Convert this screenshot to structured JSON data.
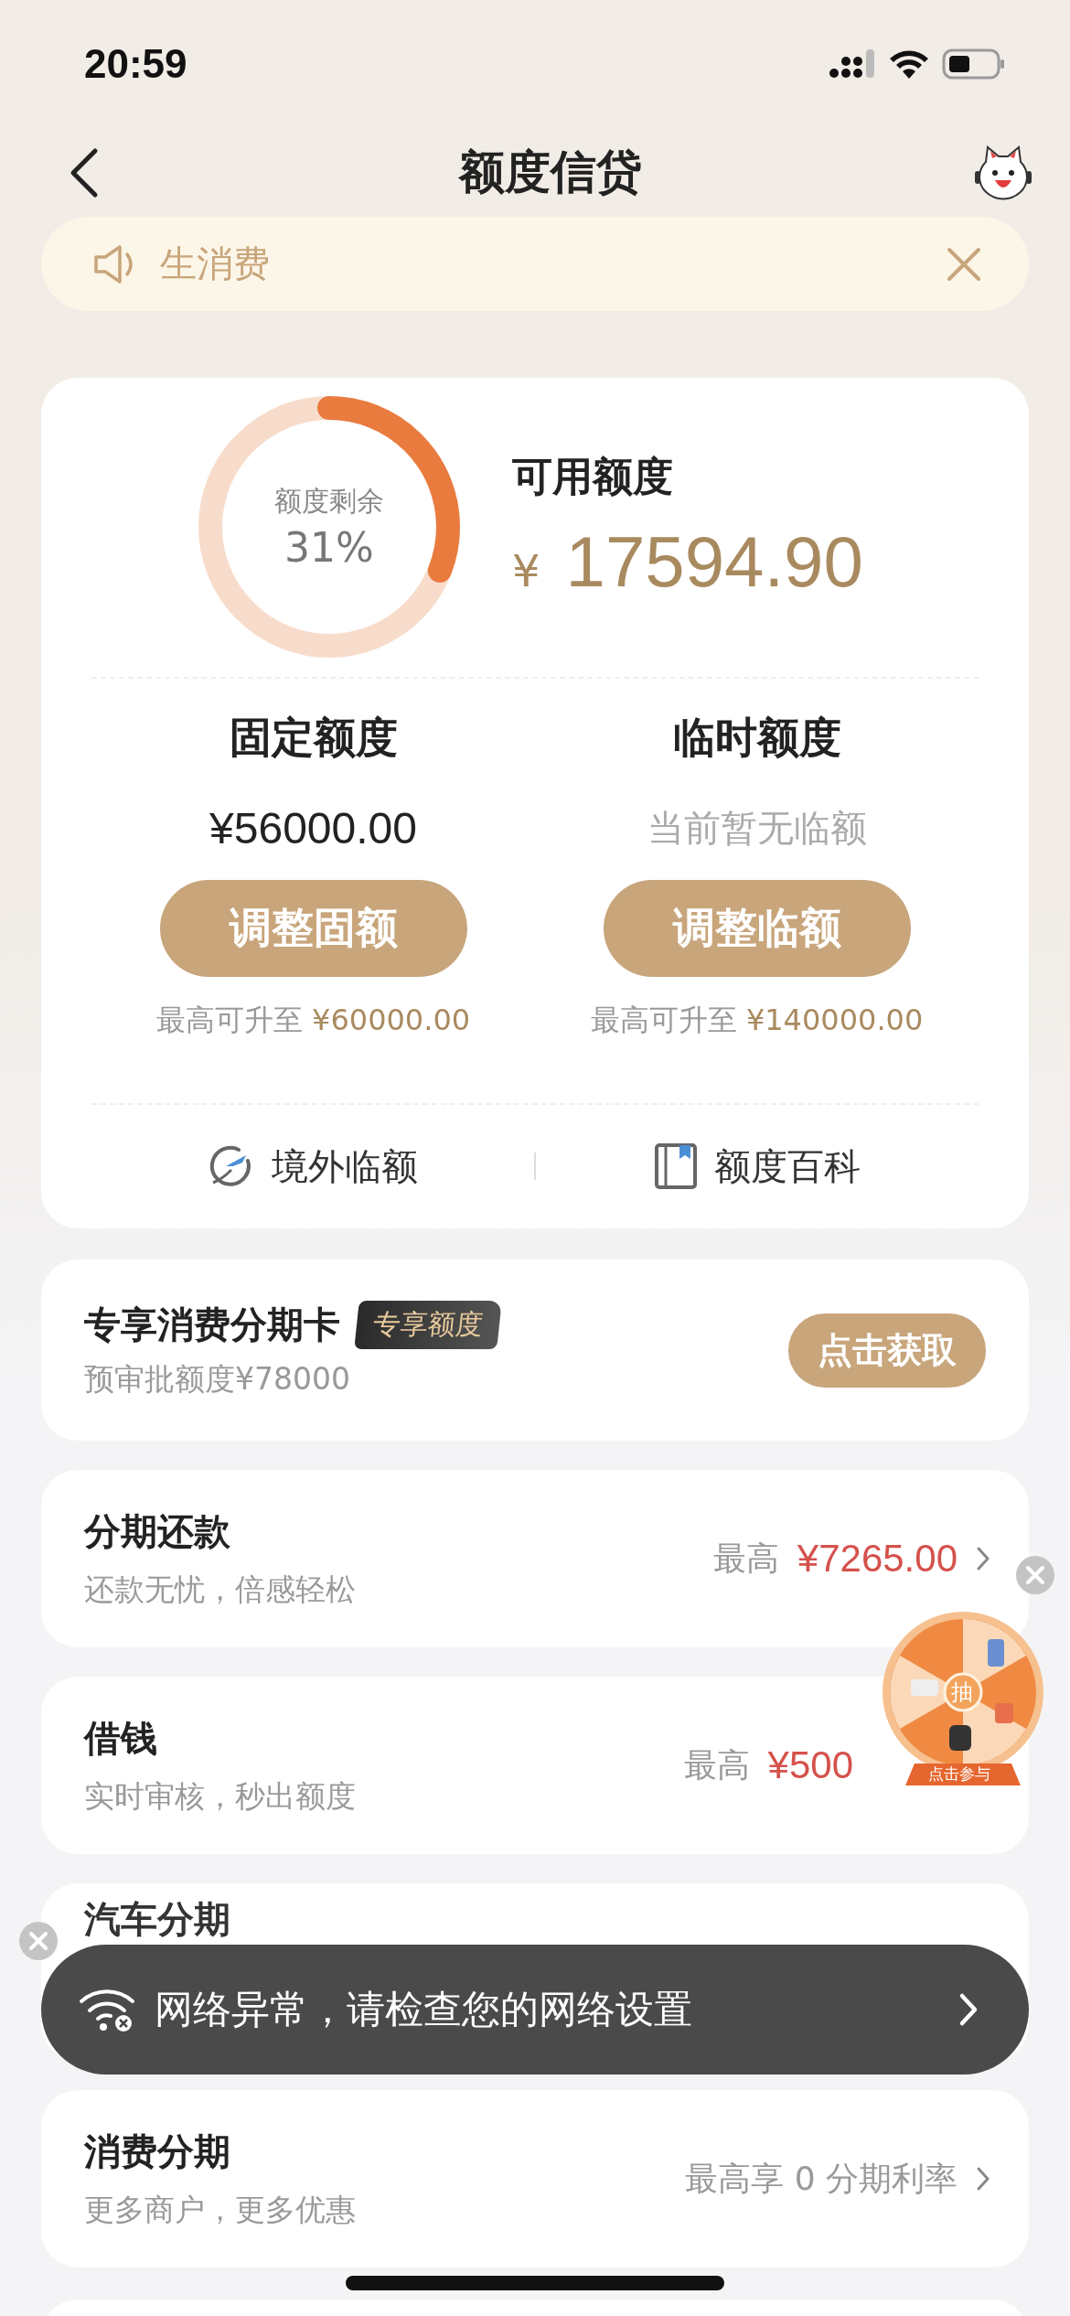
{
  "status_bar": {
    "time": "20:59"
  },
  "nav": {
    "title": "额度信贷"
  },
  "notice": {
    "text": "生消费"
  },
  "credit": {
    "ring_label": "额度剩余",
    "ring_value": "31%",
    "level": 0.31,
    "available_label": "可用额度",
    "currency": "¥",
    "available_amount": "17594.90",
    "columns": [
      {
        "title": "固定额度",
        "amount": "¥56000.00",
        "kind": "amount",
        "button": "调整固额",
        "max_label": "最高可升至",
        "max_value": "¥60000.00"
      },
      {
        "title": "临时额度",
        "amount": "当前暂无临额",
        "kind": "empty",
        "button": "调整临额",
        "max_label": "最高可升至",
        "max_value": "¥140000.00"
      }
    ],
    "links": [
      {
        "label": "境外临额",
        "kind": "plane"
      },
      {
        "label": "额度百科",
        "kind": "book"
      }
    ]
  },
  "promo": {
    "title": "专享消费分期卡",
    "tag": "专享额度",
    "subtitle": "预审批额度¥78000",
    "button": "点击获取"
  },
  "services": [
    {
      "title": "分期还款",
      "subtitle": "还款无忧，倍感轻松",
      "prefix": "最高",
      "value": "¥7265.00",
      "kind": "amount",
      "chevron": true
    },
    {
      "title": "借钱",
      "subtitle": "实时审核，秒出额度",
      "prefix": "最高",
      "value": "¥500",
      "kind": "amount",
      "chevron": false
    },
    {
      "title": "汽车分期",
      "kind": "covered"
    },
    {
      "title": "消费分期",
      "subtitle": "更多商户，更多优惠",
      "value": "最高享 0 分期利率",
      "kind": "plain",
      "chevron": true
    }
  ],
  "lottery": {
    "center": "抽",
    "caption": "点击参与"
  },
  "toast": {
    "text": "网络异常，请检查您的网络设置"
  }
}
